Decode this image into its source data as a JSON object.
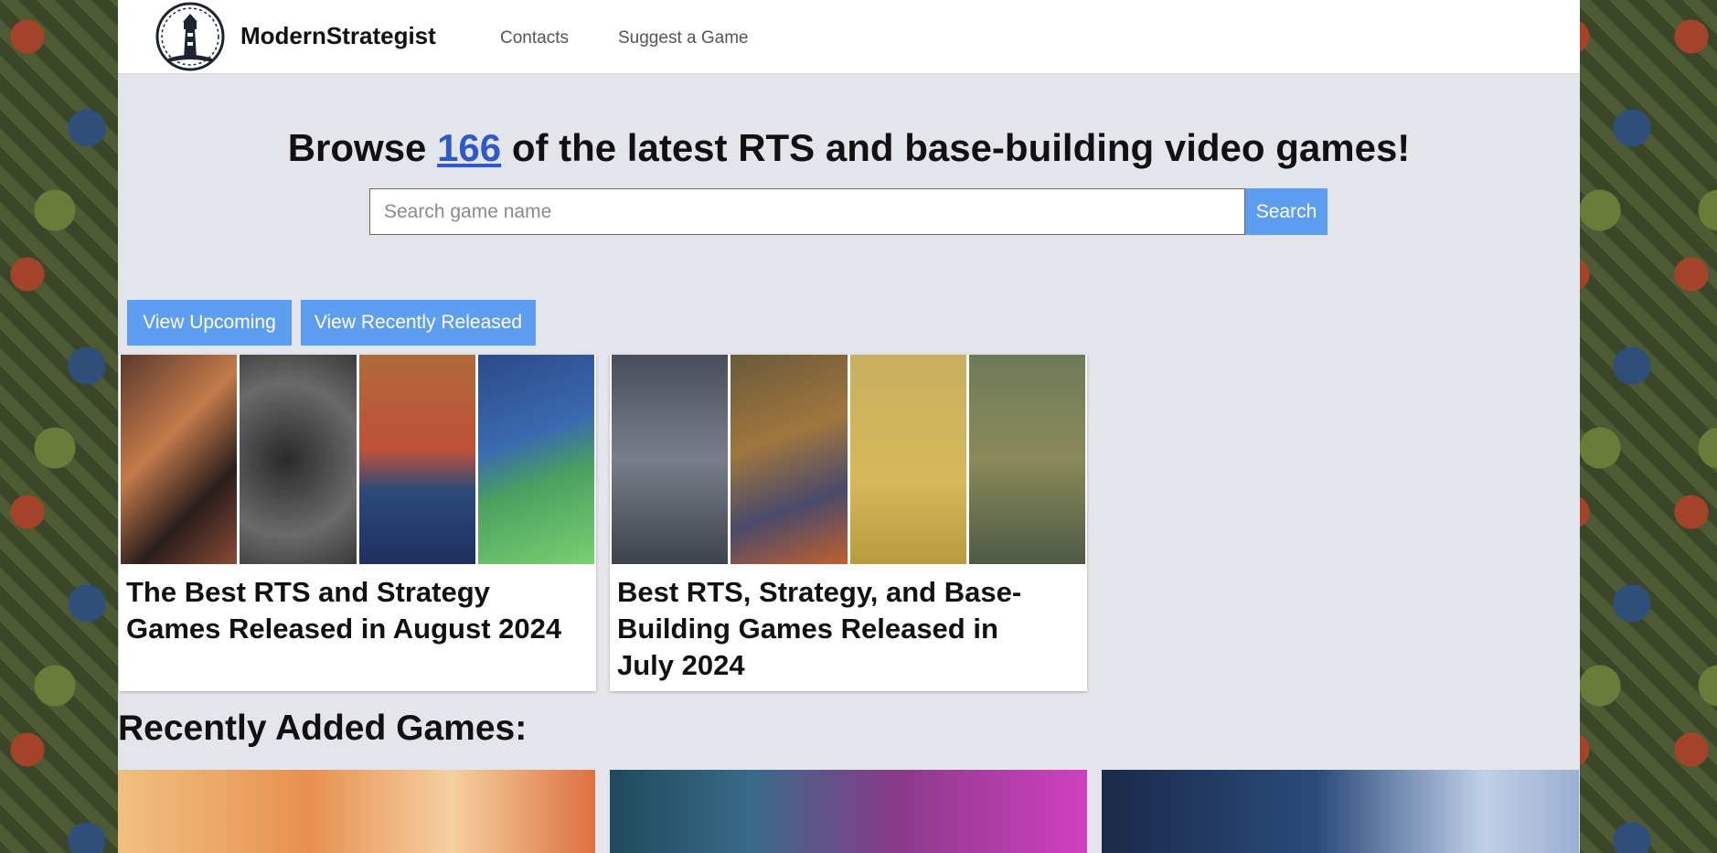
{
  "brand": {
    "name": "ModernStrategist"
  },
  "nav": {
    "contacts": "Contacts",
    "suggest": "Suggest a Game"
  },
  "hero": {
    "prefix": "Browse ",
    "count": "166",
    "suffix": " of the latest RTS and base-building video games!"
  },
  "search": {
    "placeholder": "Search game name",
    "button": "Search"
  },
  "filters": {
    "upcoming": "View Upcoming",
    "recent": "View Recently Released"
  },
  "articles": [
    {
      "title": "The Best RTS and Strategy Games Released in August 2024"
    },
    {
      "title": "Best RTS, Strategy, and Base-Building Games Released in July 2024"
    }
  ],
  "recent_section": {
    "title": "Recently Added Games:"
  },
  "colors": {
    "accent": "#5e9ef0",
    "link": "#2e59c8"
  }
}
